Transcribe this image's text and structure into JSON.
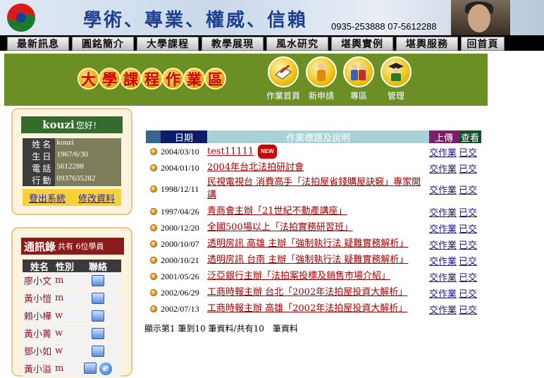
{
  "banner": {
    "slogan": "學術、專業、權威、信賴",
    "phones": "0935-253888  07-5612288"
  },
  "nav": [
    "最新訊息",
    "圓銘簡介",
    "大學課程",
    "教學展現",
    "風水研究",
    "堪輿實例",
    "堪輿服務",
    "回首頁"
  ],
  "section": {
    "title_chars": [
      "大",
      "學",
      "課",
      "程",
      "作",
      "業",
      "區"
    ],
    "icons": [
      {
        "label": "作業首頁",
        "icon": "book-pen-icon"
      },
      {
        "label": "新申請",
        "icon": "person-icon"
      },
      {
        "label": "專區",
        "icon": "group-icon"
      },
      {
        "label": "管理",
        "icon": "graduate-icon"
      }
    ]
  },
  "user": {
    "name": "kouzi",
    "greeting": "您好！",
    "fields": [
      {
        "label": "姓名",
        "value": "kouzi"
      },
      {
        "label": "生日",
        "value": "1967/6/30"
      },
      {
        "label": "電話",
        "value": "5612288"
      },
      {
        "label": "行動",
        "value": "0937635282"
      }
    ],
    "logout": "登出系統",
    "edit": "修改資料"
  },
  "contacts": {
    "title": "通訊錄",
    "count_text": "共有 6位學員",
    "headers": [
      "姓名",
      "性別",
      "聯絡"
    ],
    "rows": [
      {
        "name": "廖小文",
        "gender": "m",
        "ie": false
      },
      {
        "name": "黃小愷",
        "gender": "m",
        "ie": false
      },
      {
        "name": "賴小樺",
        "gender": "w",
        "ie": false
      },
      {
        "name": "黃小菁",
        "gender": "w",
        "ie": false
      },
      {
        "name": "鄧小如",
        "gender": "w",
        "ie": false
      },
      {
        "name": "黃小溢",
        "gender": "m",
        "ie": true
      }
    ]
  },
  "table": {
    "headers": {
      "date": "日期",
      "title": "作業標題及說明",
      "upload": "上傳",
      "view": "查看"
    },
    "rows": [
      {
        "date": "2004/03/10",
        "title": "test11111",
        "new": "NEW",
        "upload": "交作業",
        "view": "已交"
      },
      {
        "date": "2004/01/10",
        "title": "2004年台北法拍研討會",
        "upload": "交作業",
        "view": "已交"
      },
      {
        "date": "1998/12/11",
        "title": "民視電視台 消費高手「法拍屋省錢購屋訣竅」專家開講",
        "upload": "交作業",
        "view": "已交"
      },
      {
        "date": "1997/04/26",
        "title": "青商會主辦「21世紀不動產講座」",
        "upload": "交作業",
        "view": "已交"
      },
      {
        "date": "2000/12/20",
        "title": "全國500場以上「法拍實務研習班」",
        "upload": "交作業",
        "view": "已交"
      },
      {
        "date": "2000/10/07",
        "title": "透明房訊 高雄 主辦「強制執行法 疑難實務解析」",
        "upload": "交作業",
        "view": "已交"
      },
      {
        "date": "2000/10/21",
        "title": "透明房訊 台南 主辦「強制執行法 疑難實務解析」",
        "upload": "交作業",
        "view": "已交"
      },
      {
        "date": "2001/05/26",
        "title": "泛亞銀行主辦「法拍案投標及銷售市場介紹」",
        "upload": "交作業",
        "view": "已交"
      },
      {
        "date": "2002/06/29",
        "title": "工商時報主辦 台北「2002年法拍屋投資大解析」",
        "upload": "交作業",
        "view": "已交"
      },
      {
        "date": "2002/07/13",
        "title": "工商時報主辦 高雄「2002年法拍屋投資大解析」",
        "upload": "交作業",
        "view": "已交"
      }
    ],
    "footer": "顯示第1 筆到10 筆資料/共有10　筆資料"
  }
}
